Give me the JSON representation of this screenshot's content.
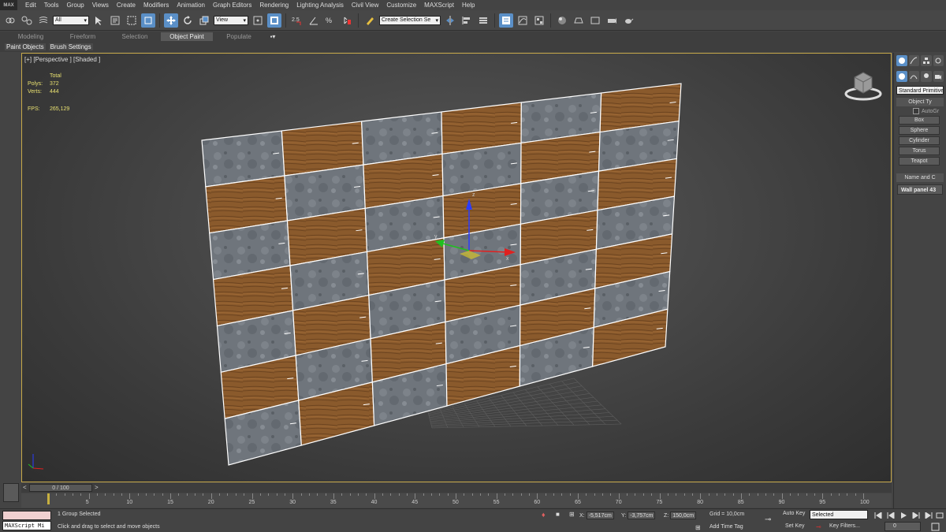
{
  "app": {
    "logo": "MAX"
  },
  "menu": [
    "Edit",
    "Tools",
    "Group",
    "Views",
    "Create",
    "Modifiers",
    "Animation",
    "Graph Editors",
    "Rendering",
    "Lighting Analysis",
    "Civil View",
    "Customize",
    "MAXScript",
    "Help"
  ],
  "toolbar": {
    "filter_value": "All",
    "ref_coord_value": "View",
    "selection_set_placeholder": "Create Selection Se",
    "snap_label": "2.5",
    "angle_label": "3"
  },
  "ribbon": {
    "tabs": [
      "Modeling",
      "Freeform",
      "Selection",
      "Object Paint",
      "Populate"
    ],
    "active_tab": "Object Paint",
    "sub_items": [
      "Paint Objects",
      "Brush Settings"
    ]
  },
  "viewport": {
    "label": "[+] [Perspective ] [Shaded ]",
    "stats_header": "Total",
    "polys_label": "Polys:",
    "polys_value": "372",
    "verts_label": "Verts:",
    "verts_value": "444",
    "fps_label": "FPS:",
    "fps_value": "265,129",
    "gizmo_axes": [
      "x",
      "y",
      "z"
    ]
  },
  "command_panel": {
    "category": "Standard Primitives",
    "object_type_title": "Object Ty",
    "autogrid_label": "AutoGr",
    "primitives": [
      "Box",
      "Sphere",
      "Cylinder",
      "Torus",
      "Teapot"
    ],
    "name_color_title": "Name and C",
    "object_name": "Wall panel 43"
  },
  "timeline": {
    "position_text": "0 / 100",
    "ticks": [
      "5",
      "10",
      "15",
      "20",
      "25",
      "30",
      "35",
      "40",
      "45",
      "50",
      "55",
      "60",
      "65",
      "70",
      "75",
      "80",
      "85",
      "90",
      "95",
      "100"
    ]
  },
  "status": {
    "maxscript_label": "MAXScript Mi",
    "selection_text": "1 Group Selected",
    "prompt_text": "Click and drag to select and move objects",
    "x_label": "X:",
    "x_value": "-5,517cm",
    "y_label": "Y:",
    "y_value": "-3,757cm",
    "z_label": "Z:",
    "z_value": "150,0cm",
    "grid_text": "Grid = 10,0cm",
    "add_time_tag": "Add Time Tag",
    "auto_key": "Auto Key",
    "set_key": "Set Key",
    "key_mode": "Selected",
    "key_filters": "Key Filters...",
    "frame_value": "0"
  },
  "colors": {
    "accent": "#5a8fc7",
    "viewport_border": "#c7a94a",
    "stats_text": "#e8e070",
    "wood": "#8a5a2c",
    "concrete": "#6f757c"
  }
}
